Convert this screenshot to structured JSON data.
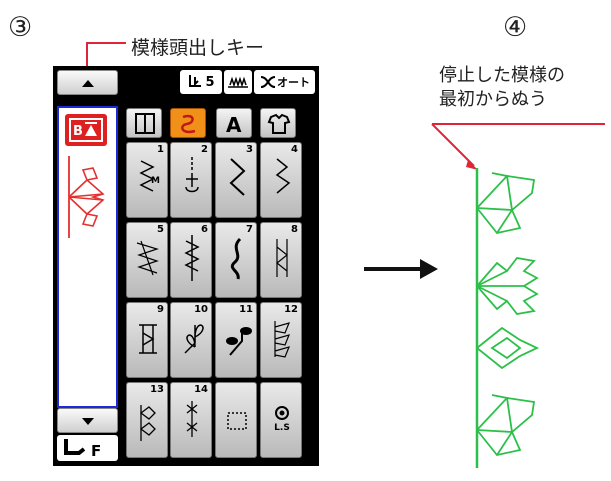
{
  "steps": {
    "step3": "③",
    "step4": "④"
  },
  "callouts": {
    "pattern_start_key": "模様頭出しキー",
    "resume_line1": "停止した模様の",
    "resume_line2": "最初からぬう"
  },
  "panel": {
    "status_bar": {
      "needle_value": "5",
      "thread_label": "オート"
    },
    "key_numbers": [
      "1",
      "2",
      "3",
      "4",
      "5",
      "6",
      "7",
      "8",
      "9",
      "10",
      "11",
      "12",
      "13",
      "14"
    ],
    "ls_label": "L.S",
    "foot_label": "F"
  },
  "colors": {
    "callout_line": "#e0243a",
    "pattern_green": "#2cc04a",
    "sidebar_border": "#1a2ad6",
    "active_tab": "#f09018"
  }
}
